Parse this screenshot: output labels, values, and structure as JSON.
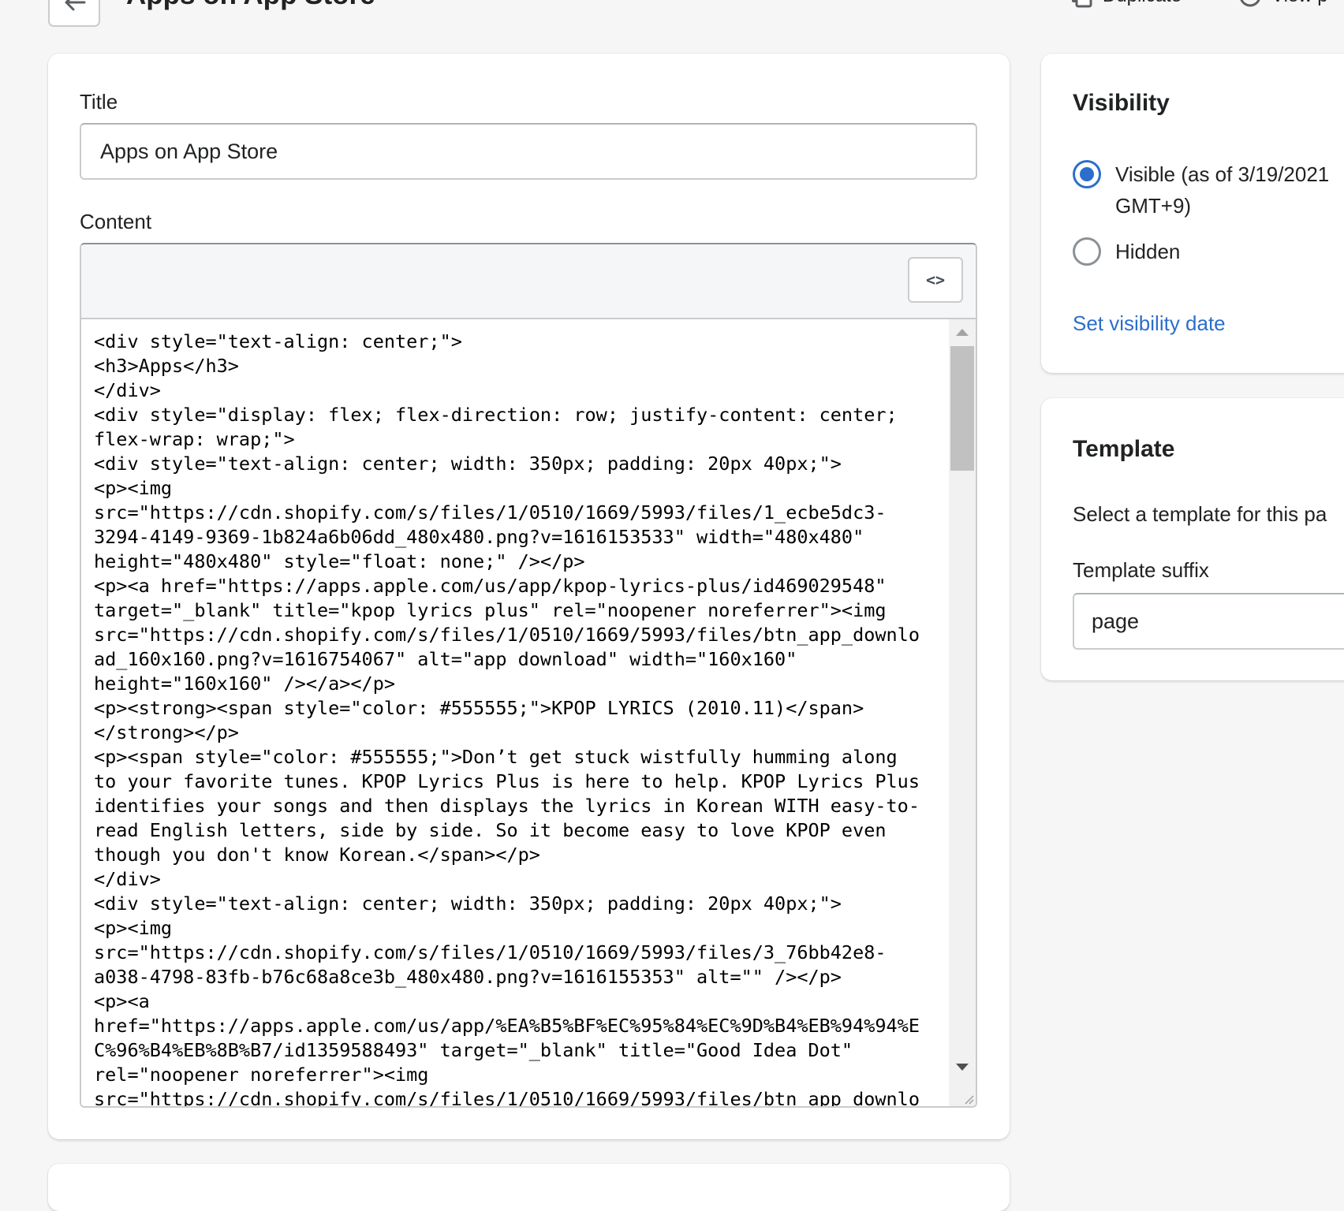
{
  "header": {
    "title": "Apps on App Store",
    "duplicate_label": "Duplicate",
    "view_label": "View p"
  },
  "form": {
    "title_label": "Title",
    "title_value": "Apps on App Store",
    "content_label": "Content",
    "source_toggle_label": "<>",
    "code": "<div style=\"text-align: center;\">\n<h3>Apps</h3>\n</div>\n<div style=\"display: flex; flex-direction: row; justify-content: center;\nflex-wrap: wrap;\">\n<div style=\"text-align: center; width: 350px; padding: 20px 40px;\">\n<p><img\nsrc=\"https://cdn.shopify.com/s/files/1/0510/1669/5993/files/1_ecbe5dc3-\n3294-4149-9369-1b824a6b06dd_480x480.png?v=1616153533\" width=\"480x480\"\nheight=\"480x480\" style=\"float: none;\" /></p>\n<p><a href=\"https://apps.apple.com/us/app/kpop-lyrics-plus/id469029548\"\ntarget=\"_blank\" title=\"kpop lyrics plus\" rel=\"noopener noreferrer\"><img\nsrc=\"https://cdn.shopify.com/s/files/1/0510/1669/5993/files/btn_app_downlo\nad_160x160.png?v=1616754067\" alt=\"app download\" width=\"160x160\"\nheight=\"160x160\" /></a></p>\n<p><strong><span style=\"color: #555555;\">KPOP LYRICS (2010.11)</span>\n</strong></p>\n<p><span style=\"color: #555555;\">Don’t get stuck wistfully humming along\nto your favorite tunes. KPOP Lyrics Plus is here to help. KPOP Lyrics Plus\nidentifies your songs and then displays the lyrics in Korean WITH easy-to-\nread English letters, side by side. So it become easy to love KPOP even\nthough you don't know Korean.</span></p>\n</div>\n<div style=\"text-align: center; width: 350px; padding: 20px 40px;\">\n<p><img\nsrc=\"https://cdn.shopify.com/s/files/1/0510/1669/5993/files/3_76bb42e8-\na038-4798-83fb-b76c68a8ce3b_480x480.png?v=1616155353\" alt=\"\" /></p>\n<p><a\nhref=\"https://apps.apple.com/us/app/%EA%B5%BF%EC%95%84%EC%9D%B4%EB%94%94%E\nC%96%B4%EB%8B%B7/id1359588493\" target=\"_blank\" title=\"Good Idea Dot\"\nrel=\"noopener noreferrer\"><img\nsrc=\"https://cdn.shopify.com/s/files/1/0510/1669/5993/files/btn_app_downlo"
  },
  "visibility": {
    "heading": "Visibility",
    "options": [
      {
        "label": "Visible (as of 3/19/2021\nGMT+9)",
        "checked": true
      },
      {
        "label": "Hidden",
        "checked": false
      }
    ],
    "set_date_link": "Set visibility date"
  },
  "template": {
    "heading": "Template",
    "description": "Select a template for this pa",
    "suffix_label": "Template suffix",
    "suffix_value": "page"
  },
  "colors": {
    "accent": "#2c6ecb",
    "page_background": "#f6f6f7",
    "card_background": "#ffffff",
    "border": "#c9cccf",
    "text": "#202223"
  }
}
